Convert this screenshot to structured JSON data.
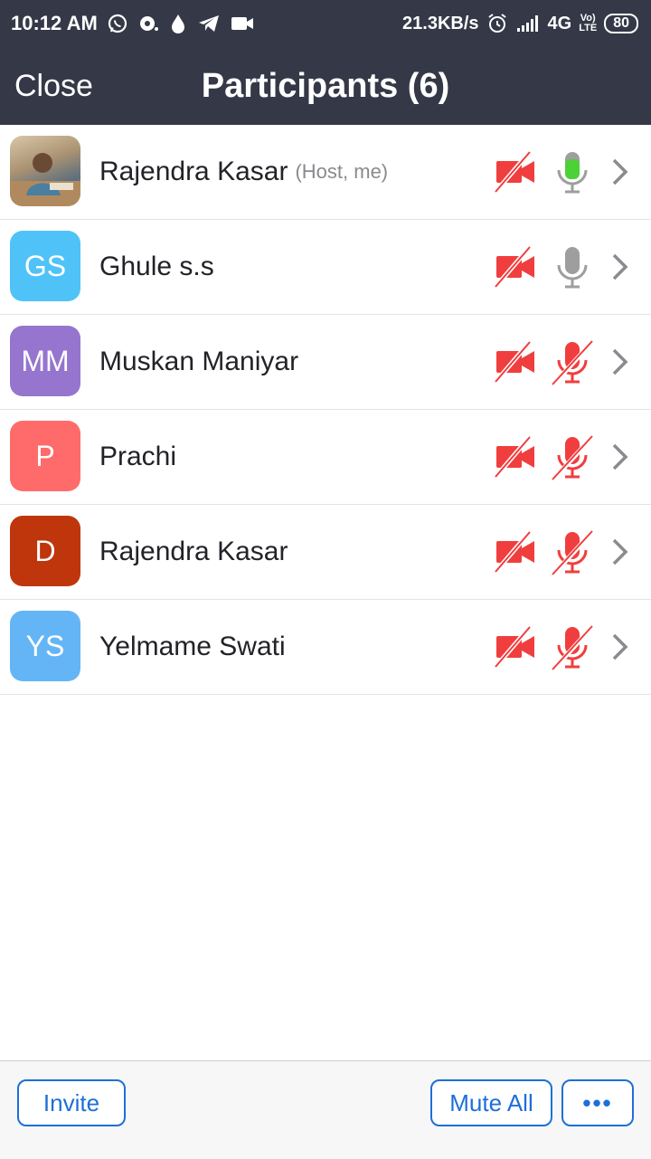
{
  "status_bar": {
    "time": "10:12 AM",
    "speed": "21.3KB/s",
    "network": "4G",
    "volte_top": "Vo)",
    "volte_bottom": "LTE",
    "battery": "80"
  },
  "header": {
    "close_label": "Close",
    "title": "Participants (6)"
  },
  "participants": [
    {
      "initials": "",
      "name": "Rajendra Kasar",
      "tag": "(Host, me)",
      "avatar_color": "#a99272",
      "video": "off",
      "audio": "speaking"
    },
    {
      "initials": "GS",
      "name": "Ghule s.s",
      "tag": "",
      "avatar_color": "#4fc3f7",
      "video": "off",
      "audio": "on"
    },
    {
      "initials": "MM",
      "name": "Muskan Maniyar",
      "tag": "",
      "avatar_color": "#9575cd",
      "video": "off",
      "audio": "muted"
    },
    {
      "initials": "P",
      "name": "Prachi",
      "tag": "",
      "avatar_color": "#ff6b6b",
      "video": "off",
      "audio": "muted"
    },
    {
      "initials": "D",
      "name": "Rajendra Kasar",
      "tag": "",
      "avatar_color": "#bf360c",
      "video": "off",
      "audio": "muted"
    },
    {
      "initials": "YS",
      "name": "Yelmame Swati",
      "tag": "",
      "avatar_color": "#64b5f6",
      "video": "off",
      "audio": "muted"
    }
  ],
  "footer": {
    "invite_label": "Invite",
    "mute_all_label": "Mute All",
    "more_label": "•••"
  },
  "colors": {
    "header_bg": "#353847",
    "muted_red": "#f03e3e",
    "mic_gray": "#9e9e9e",
    "speaking_green": "#4cd137",
    "accent_blue": "#1d6fd8"
  }
}
